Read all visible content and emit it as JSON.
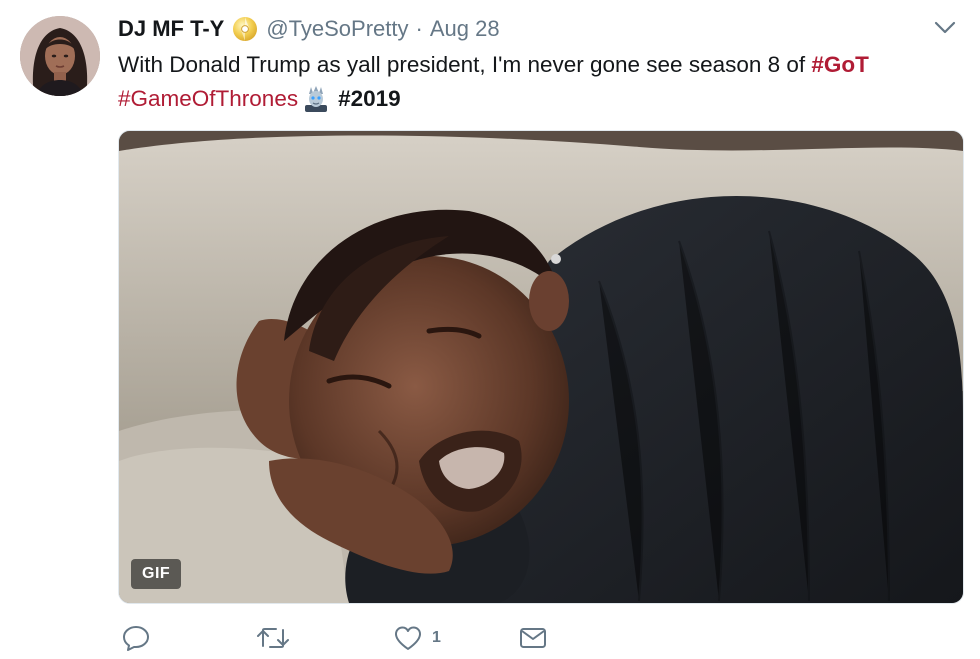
{
  "tweet": {
    "author": {
      "name": "DJ MF T-Y",
      "handle": "@TyeSoPretty",
      "verified_badge_icon": "cd-disc-emoji"
    },
    "separator": "·",
    "date": "Aug 28",
    "text": {
      "line1_plain": "With Donald Trump as yall president, I'm never gone see season 8 of ",
      "hashtag_got": "#GoT",
      "hashtag_gameofthrones": "#GameOfThrones",
      "emoji": "night-king-emoji",
      "hashtag_2019": "#2019"
    },
    "media": {
      "type": "gif",
      "badge": "GIF"
    },
    "actions": {
      "reply_icon": "reply-icon",
      "retweet_icon": "retweet-icon",
      "like_icon": "heart-icon",
      "like_count": "1",
      "dm_icon": "envelope-icon"
    }
  },
  "colors": {
    "hashtag": "#b01c35",
    "secondary_text": "#657786",
    "primary_text": "#14171a"
  }
}
